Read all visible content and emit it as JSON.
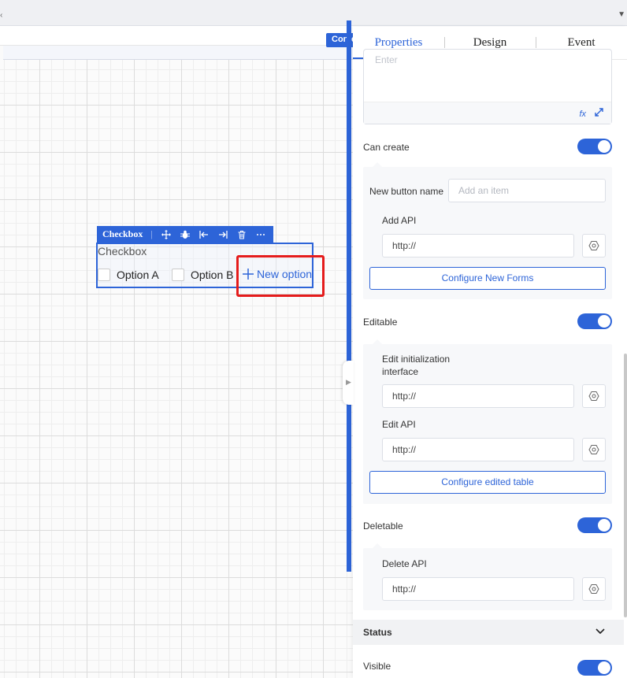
{
  "canvas": {
    "container_tag": "Conte",
    "checkbox_toolbar": {
      "title": "Checkbox",
      "separator": "|"
    },
    "checkbox_component": {
      "label": "Checkbox",
      "options": [
        "Option A",
        "Option B"
      ],
      "new_option_label": "New option"
    }
  },
  "panel": {
    "tabs": [
      {
        "label": "Properties",
        "active": true
      },
      {
        "label": "Design",
        "active": false
      },
      {
        "label": "Event",
        "active": false
      }
    ],
    "expression_input": {
      "placeholder": "Enter",
      "fx_label": "fx"
    },
    "can_create": {
      "label": "Can create",
      "enabled": true,
      "new_button_name_label": "New button name",
      "new_button_name_placeholder": "Add an item",
      "add_api_label": "Add API",
      "add_api_value": "http://",
      "configure_button": "Configure New Forms"
    },
    "editable": {
      "label": "Editable",
      "enabled": true,
      "init_interface_label_line1": "Edit initialization",
      "init_interface_label_line2": "interface",
      "init_interface_value": "http://",
      "edit_api_label": "Edit API",
      "edit_api_value": "http://",
      "configure_button": "Configure edited table"
    },
    "deletable": {
      "label": "Deletable",
      "enabled": true,
      "delete_api_label": "Delete API",
      "delete_api_value": "http://"
    },
    "status_section": {
      "title": "Status"
    },
    "visible": {
      "label": "Visible",
      "enabled": true
    }
  },
  "colors": {
    "accent": "#2d64d8",
    "highlight": "#e51c1c"
  }
}
